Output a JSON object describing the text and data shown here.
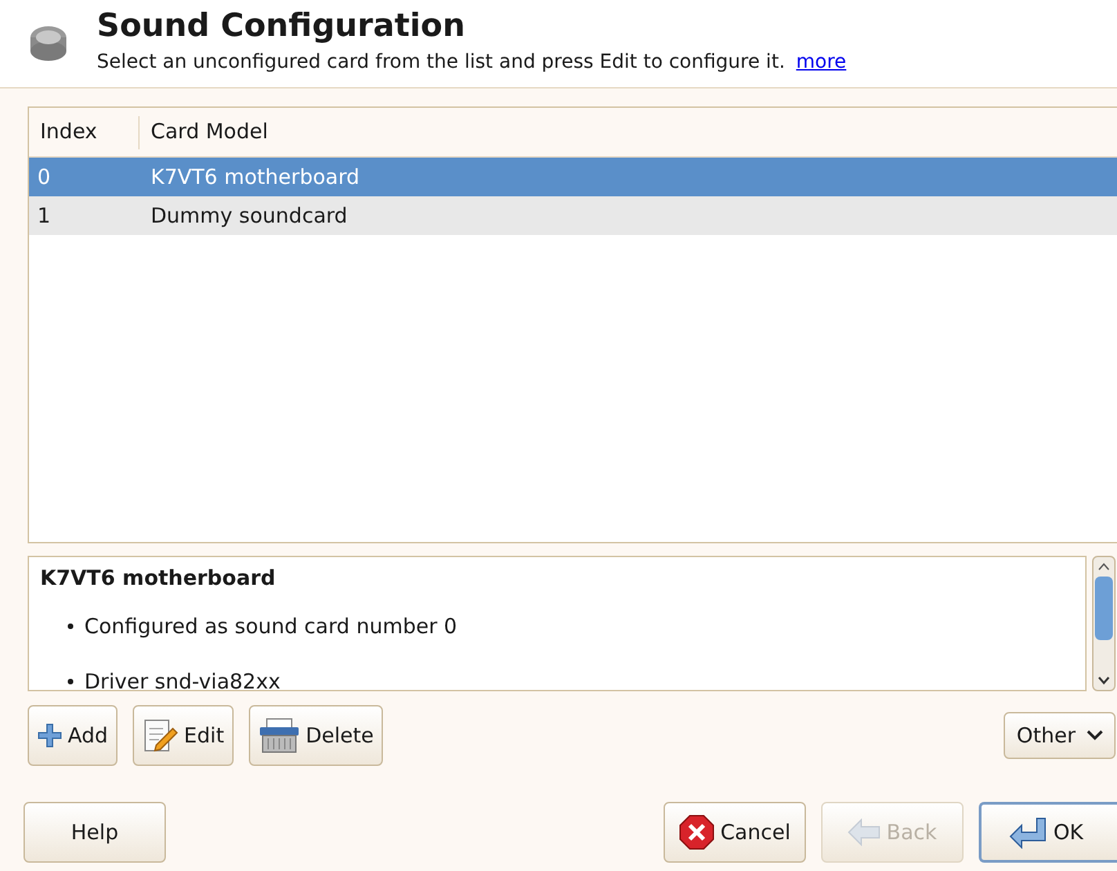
{
  "header": {
    "title": "Sound Configuration",
    "subtitle": "Select an unconfigured card from the list and press Edit to configure it.",
    "more_link": "more"
  },
  "table": {
    "columns": [
      "Index",
      "Card Model"
    ],
    "rows": [
      {
        "cells": [
          "0",
          "K7VT6 motherboard"
        ],
        "selected": true
      },
      {
        "cells": [
          "1",
          "Dummy soundcard"
        ],
        "selected": false
      }
    ]
  },
  "details": {
    "title": "K7VT6 motherboard",
    "items": [
      "Configured as sound card number 0",
      "Driver snd-via82xx"
    ]
  },
  "actions": [
    {
      "kind": "add",
      "label": "Add"
    },
    {
      "kind": "edit",
      "label": "Edit"
    },
    {
      "kind": "delete",
      "label": "Delete"
    }
  ],
  "other_button": {
    "label": "Other"
  },
  "footer": [
    {
      "kind": "help",
      "label": "Help",
      "disabled": false,
      "focused": false
    },
    {
      "kind": "cancel",
      "label": "Cancel",
      "disabled": false,
      "focused": false
    },
    {
      "kind": "back",
      "label": "Back",
      "disabled": true,
      "focused": false
    },
    {
      "kind": "ok",
      "label": "OK",
      "disabled": false,
      "focused": true
    }
  ]
}
